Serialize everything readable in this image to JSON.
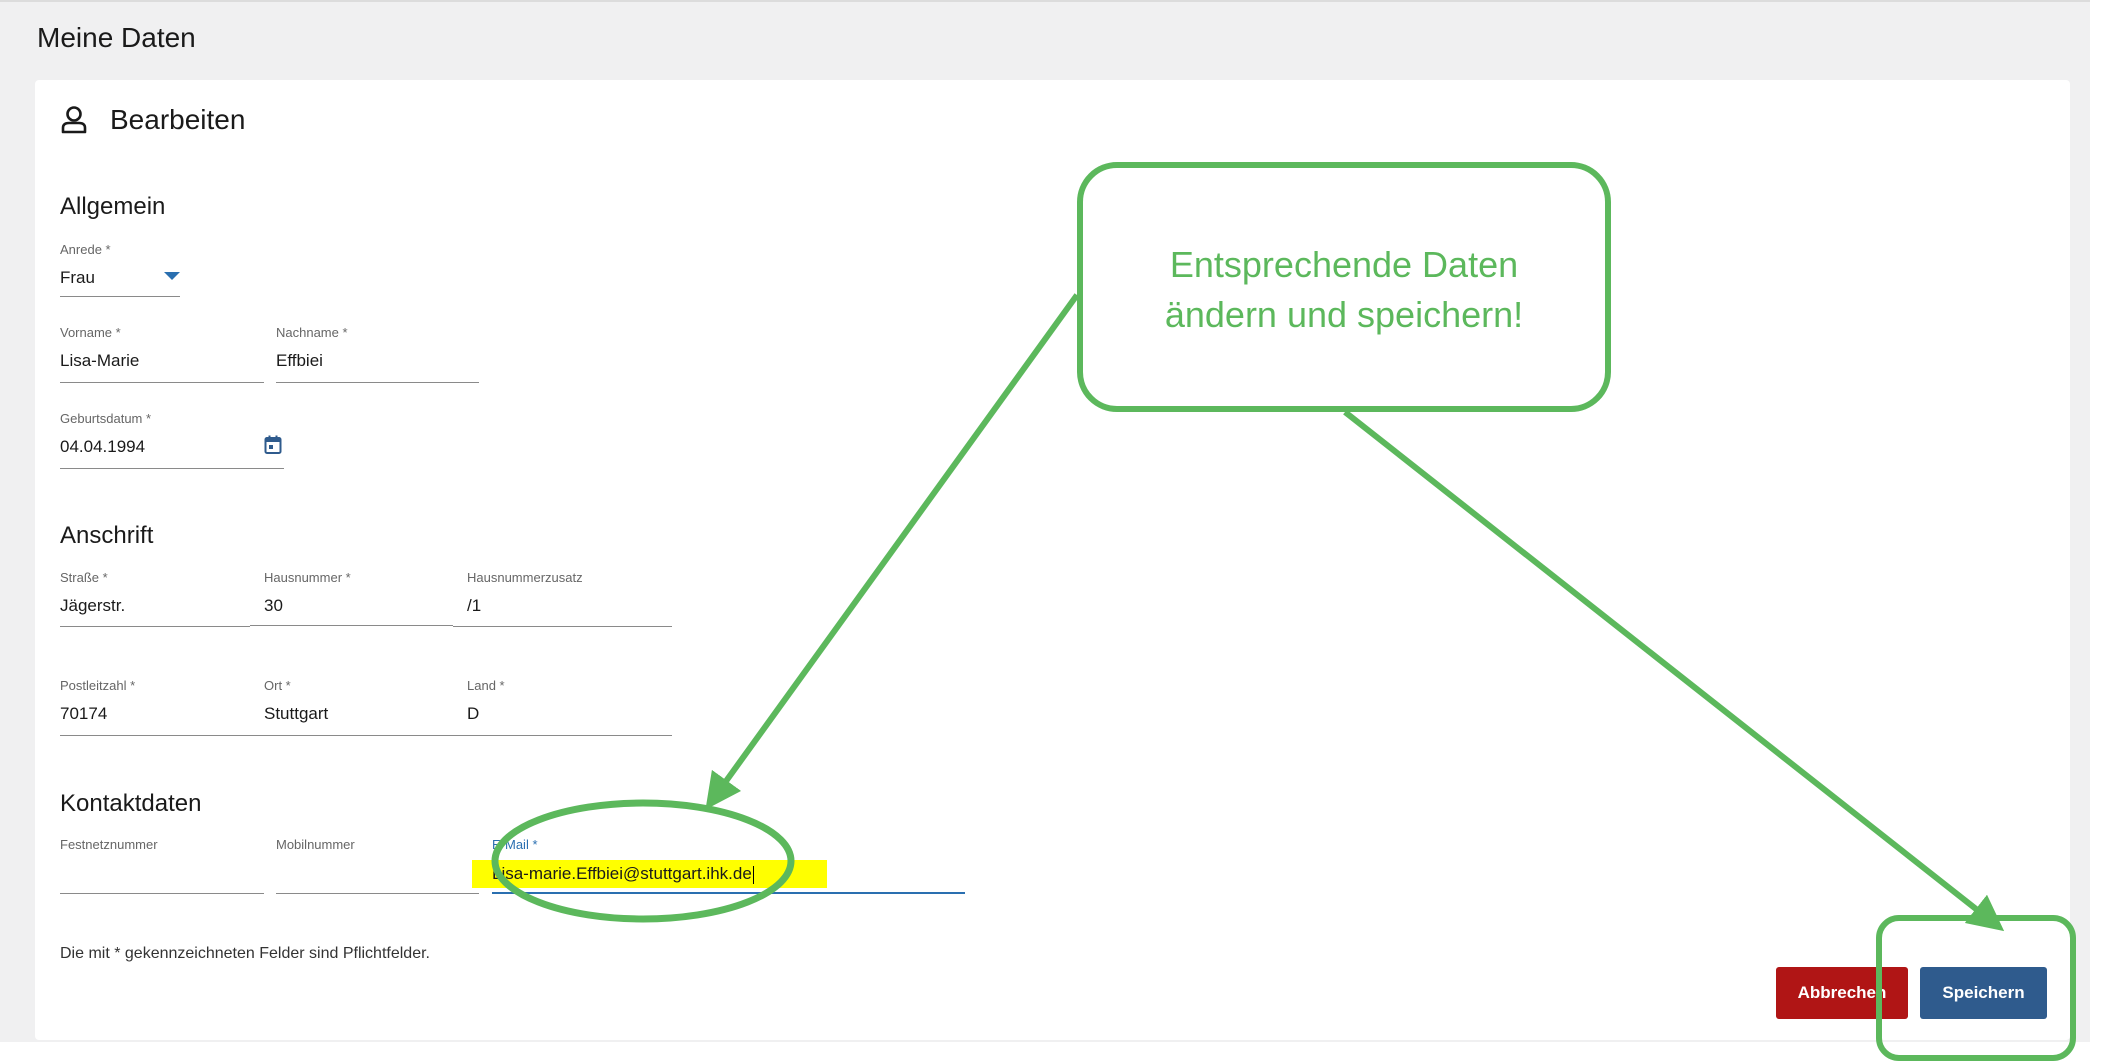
{
  "page": {
    "title": "Meine Daten"
  },
  "card": {
    "title": "Bearbeiten",
    "icon": "user-icon"
  },
  "sections": {
    "allgemein": "Allgemein",
    "anschrift": "Anschrift",
    "kontaktdaten": "Kontaktdaten"
  },
  "fields": {
    "anrede": {
      "label": "Anrede *",
      "value": "Frau"
    },
    "vorname": {
      "label": "Vorname *",
      "value": "Lisa-Marie"
    },
    "nachname": {
      "label": "Nachname *",
      "value": "Effbiei"
    },
    "geburtsdatum": {
      "label": "Geburtsdatum *",
      "value": "04.04.1994",
      "icon": "calendar-icon"
    },
    "strasse": {
      "label": "Straße *",
      "value": "Jägerstr."
    },
    "hausnummer": {
      "label": "Hausnummer *",
      "value": "30"
    },
    "hausnummerzusatz": {
      "label": "Hausnummerzusatz",
      "value": "/1"
    },
    "postleitzahl": {
      "label": "Postleitzahl *",
      "value": "70174"
    },
    "ort": {
      "label": "Ort *",
      "value": "Stuttgart"
    },
    "land": {
      "label": "Land *",
      "value": "D"
    },
    "festnetz": {
      "label": "Festnetznummer",
      "value": ""
    },
    "mobil": {
      "label": "Mobilnummer",
      "value": ""
    },
    "email": {
      "label": "E-Mail *",
      "value": "Lisa-marie.Effbiei@stuttgart.ihk.de"
    }
  },
  "footnote": "Die mit * gekennzeichneten Felder sind Pflichtfelder.",
  "buttons": {
    "cancel": "Abbrechen",
    "save": "Speichern"
  },
  "callout": {
    "line1": "Entsprechende Daten",
    "line2": "ändern und speichern!"
  },
  "colors": {
    "annotation": "#5cb85c",
    "cancel": "#b01515",
    "save": "#2f5b8d",
    "active_field": "#2a6fb0",
    "highlight": "#ffff00"
  }
}
